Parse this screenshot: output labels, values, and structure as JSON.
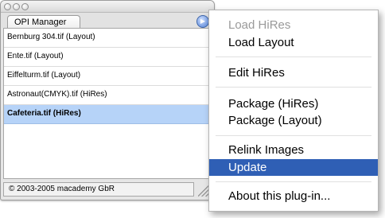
{
  "palette": {
    "tab_label": "OPI Manager",
    "menu_trigger_glyph": "▶",
    "items": [
      {
        "label": "Bernburg 304.tif (Layout)",
        "selected": false
      },
      {
        "label": "Ente.tif (Layout)",
        "selected": false
      },
      {
        "label": "Eiffelturm.tif (Layout)",
        "selected": false
      },
      {
        "label": "Astronaut(CMYK).tif (HiRes)",
        "selected": false
      },
      {
        "label": "Cafeteria.tif (HiRes)",
        "selected": true
      }
    ],
    "footer": "© 2003-2005 macademy GbR"
  },
  "menu": {
    "items": [
      {
        "label": "Load HiRes",
        "state": "disabled"
      },
      {
        "label": "Load Layout",
        "state": "normal"
      },
      {
        "label": "Edit HiRes",
        "state": "normal"
      },
      {
        "label": "Package (HiRes)",
        "state": "normal"
      },
      {
        "label": "Package (Layout)",
        "state": "normal"
      },
      {
        "label": "Relink Images",
        "state": "normal"
      },
      {
        "label": "Update",
        "state": "highlighted"
      },
      {
        "label": "About this plug-in...",
        "state": "normal"
      }
    ]
  },
  "colors": {
    "highlight": "#2f5fb5",
    "selection": "#b6d3f8",
    "disabled_text": "#9a9a9a"
  }
}
